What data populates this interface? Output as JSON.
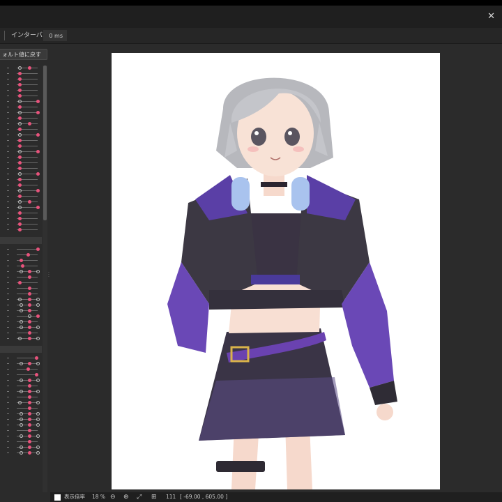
{
  "window": {
    "close_glyph": "✕"
  },
  "toolbar": {
    "interval_label": "インターバル：",
    "interval_value": "0 ms"
  },
  "panel": {
    "reset_label": "ォルト値に戻す"
  },
  "status": {
    "zoom_label": "表示倍率",
    "zoom_value": "18 %",
    "rotation_value": "111",
    "coords": "[ -69.00 , 605.00 ]"
  },
  "colors": {
    "key_on": "#e8537c",
    "canvas_bg": "#ffffff",
    "panel_bg": "#2b2b2b"
  },
  "icons": [
    "zoom-out-icon",
    "zoom-in-icon",
    "fit-screen-icon",
    "actual-size-icon"
  ]
}
